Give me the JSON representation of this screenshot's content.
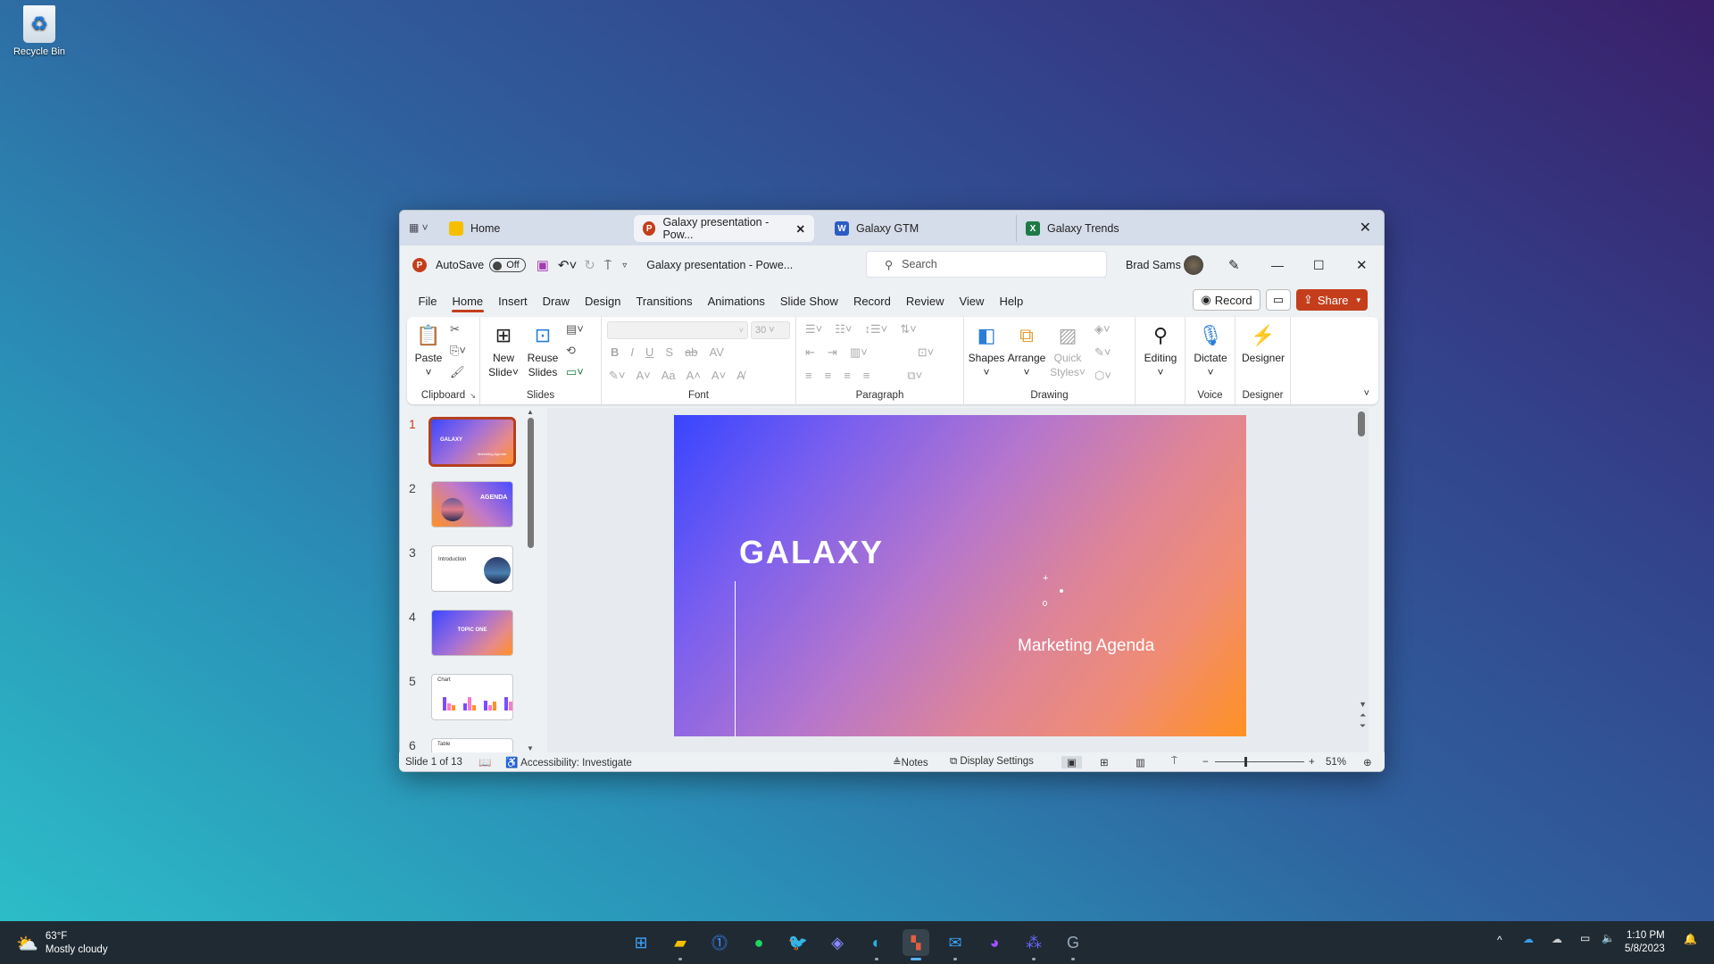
{
  "desktop": {
    "recycle_bin": "Recycle Bin"
  },
  "tabs": [
    {
      "label": "Home",
      "icon": "folder-icon"
    },
    {
      "label": "Galaxy presentation - Pow...",
      "icon": "powerpoint-icon",
      "active": true
    },
    {
      "label": "Galaxy GTM",
      "icon": "word-icon"
    },
    {
      "label": "Galaxy Trends",
      "icon": "excel-icon"
    }
  ],
  "titlebar": {
    "autosave": "AutoSave",
    "autosave_state": "Off",
    "doc_title": "Galaxy presentation  -  Powe...",
    "search_placeholder": "Search",
    "user": "Brad Sams"
  },
  "menu": [
    "File",
    "Home",
    "Insert",
    "Draw",
    "Design",
    "Transitions",
    "Animations",
    "Slide Show",
    "Record",
    "Review",
    "View",
    "Help"
  ],
  "menu_right": {
    "record": "Record",
    "share": "Share"
  },
  "ribbon": {
    "clipboard": {
      "label": "Clipboard",
      "paste": "Paste"
    },
    "slides": {
      "label": "Slides",
      "new_slide_1": "New",
      "new_slide_2": "Slide",
      "reuse_1": "Reuse",
      "reuse_2": "Slides"
    },
    "font": {
      "label": "Font",
      "size": "30",
      "bold": "B",
      "italic": "I",
      "underline": "U",
      "shadow": "S",
      "strike": "ab",
      "spacing": "AV",
      "case": "Aa",
      "grow": "A˄",
      "shrink": "A˅"
    },
    "paragraph": {
      "label": "Paragraph"
    },
    "drawing": {
      "label": "Drawing",
      "shapes": "Shapes",
      "arrange": "Arrange",
      "quick_1": "Quick",
      "quick_2": "Styles"
    },
    "editing": {
      "label": "Editing"
    },
    "voice": {
      "label": "Voice",
      "dictate": "Dictate"
    },
    "designer": {
      "label": "Designer",
      "button": "Designer"
    }
  },
  "thumbnails": [
    {
      "num": "1",
      "title": "GALAXY",
      "subtitle": "Marketing Agenda"
    },
    {
      "num": "2",
      "title": "AGENDA"
    },
    {
      "num": "3",
      "title": "Introduction"
    },
    {
      "num": "4",
      "title": "TOPIC ONE"
    },
    {
      "num": "5",
      "title": "Chart"
    },
    {
      "num": "6",
      "title": "Table"
    }
  ],
  "slide": {
    "title": "GALAXY",
    "subtitle": "Marketing Agenda"
  },
  "status": {
    "slide": "Slide 1 of 13",
    "accessibility": "Accessibility: Investigate",
    "notes": "Notes",
    "display": "Display Settings",
    "zoom": "51%",
    "zoom_value": 51
  },
  "taskbar": {
    "temp": "63°F",
    "weather": "Mostly cloudy",
    "time": "1:10 PM",
    "date": "5/8/2023"
  },
  "colors": {
    "accent": "#c43e1c",
    "share": "#c43e1c"
  }
}
